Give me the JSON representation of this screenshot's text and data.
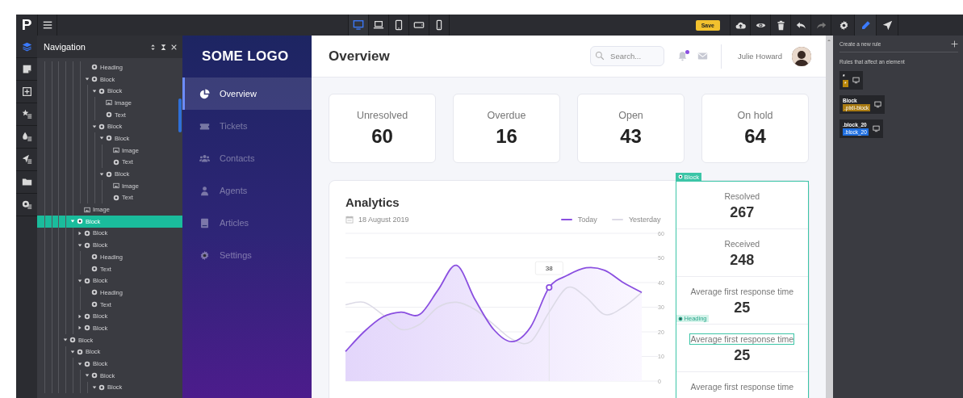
{
  "toolbar": {
    "logo": "P",
    "devices": [
      {
        "kind": "desktop",
        "selected": true
      },
      {
        "kind": "laptop",
        "selected": false
      },
      {
        "kind": "tablet",
        "selected": false
      },
      {
        "kind": "tablet-landscape",
        "selected": false
      },
      {
        "kind": "phone",
        "selected": false
      }
    ],
    "save": "Save",
    "tools": [
      {
        "kind": "upload",
        "disabled": false
      },
      {
        "kind": "preview",
        "disabled": false
      },
      {
        "kind": "delete",
        "disabled": false
      },
      {
        "kind": "undo",
        "disabled": false
      },
      {
        "kind": "redo",
        "disabled": true
      }
    ],
    "panels": [
      {
        "kind": "settings",
        "selected": false
      },
      {
        "kind": "style",
        "selected": true
      },
      {
        "kind": "publish",
        "selected": false
      }
    ]
  },
  "rail": [
    {
      "kind": "layers",
      "selected": true
    },
    {
      "kind": "page",
      "selected": false
    },
    {
      "kind": "add",
      "selected": false
    },
    {
      "kind": "favorites",
      "selected": false
    },
    {
      "kind": "theme",
      "selected": false
    },
    {
      "kind": "send",
      "selected": false
    },
    {
      "kind": "folder",
      "selected": false
    },
    {
      "kind": "settings",
      "selected": false
    }
  ],
  "navigator": {
    "title": "Navigation",
    "tree": [
      {
        "children": [
          {
            "children": [
              {
                "children": [
                  {
                    "label": "Heading",
                    "kind": "heading",
                    "selected": false
                  },
                  {
                    "label": "Block",
                    "kind": "block",
                    "expanded": true,
                    "selected": false,
                    "children": [
                      {
                        "label": "Block",
                        "kind": "block",
                        "expanded": true,
                        "selected": false,
                        "children": [
                          {
                            "label": "Image",
                            "kind": "image",
                            "selected": false
                          },
                          {
                            "label": "Text",
                            "kind": "text",
                            "selected": false
                          }
                        ]
                      },
                      {
                        "label": "Block",
                        "kind": "block",
                        "expanded": true,
                        "selected": false,
                        "children": [
                          {
                            "label": "Block",
                            "kind": "block",
                            "expanded": true,
                            "selected": false,
                            "children": [
                              {
                                "label": "Image",
                                "kind": "image",
                                "selected": false
                              },
                              {
                                "label": "Text",
                                "kind": "text",
                                "selected": false
                              }
                            ]
                          },
                          {
                            "label": "Block",
                            "kind": "block",
                            "expanded": true,
                            "selected": false,
                            "children": [
                              {
                                "label": "Image",
                                "kind": "image",
                                "selected": false
                              },
                              {
                                "label": "Text",
                                "kind": "text",
                                "selected": false
                              }
                            ]
                          }
                        ]
                      }
                    ]
                  }
                ]
              },
              {
                "label": "Image",
                "kind": "image",
                "selected": false
              }
            ]
          },
          {
            "label": "Block",
            "kind": "block",
            "expanded": true,
            "selected": true,
            "children": [
              {
                "label": "Block",
                "kind": "block",
                "expanded": false,
                "selected": false
              },
              {
                "label": "Block",
                "kind": "block",
                "expanded": true,
                "selected": false,
                "children": [
                  {
                    "label": "Heading",
                    "kind": "heading",
                    "selected": false
                  },
                  {
                    "label": "Text",
                    "kind": "text",
                    "selected": false
                  }
                ]
              },
              {
                "label": "Block",
                "kind": "block",
                "expanded": true,
                "selected": false,
                "children": [
                  {
                    "label": "Heading",
                    "kind": "heading",
                    "selected": false
                  },
                  {
                    "label": "Text",
                    "kind": "text",
                    "selected": false
                  }
                ]
              },
              {
                "label": "Block",
                "kind": "block",
                "expanded": false,
                "selected": false
              },
              {
                "label": "Block",
                "kind": "block",
                "expanded": false,
                "selected": false
              }
            ]
          }
        ]
      },
      {
        "label": "Block",
        "kind": "block",
        "expanded": true,
        "selected": false,
        "children": [
          {
            "label": "Block",
            "kind": "block",
            "expanded": true,
            "selected": false,
            "children": [
              {
                "label": "Block",
                "kind": "block",
                "expanded": true,
                "selected": false,
                "children": [
                  {
                    "label": "Block",
                    "kind": "block",
                    "expanded": true,
                    "selected": false,
                    "children": [
                      {
                        "label": "Block",
                        "kind": "block",
                        "expanded": true,
                        "selected": false
                      }
                    ]
                  }
                ]
              }
            ]
          }
        ]
      }
    ]
  },
  "site": {
    "logo": "SOME LOGO",
    "menu": [
      {
        "label": "Overview",
        "kind": "overview",
        "selected": true
      },
      {
        "label": "Tickets",
        "kind": "tickets",
        "selected": false
      },
      {
        "label": "Contacts",
        "kind": "contacts",
        "selected": false
      },
      {
        "label": "Agents",
        "kind": "agents",
        "selected": false
      },
      {
        "label": "Articles",
        "kind": "articles",
        "selected": false
      },
      {
        "label": "Settings",
        "kind": "settings",
        "selected": false
      }
    ],
    "header": {
      "title": "Overview",
      "search": {
        "placeholder": "Search..."
      },
      "notifications_unread": true,
      "user": "Julie Howard"
    },
    "stats": [
      {
        "label": "Unresolved",
        "value": "60"
      },
      {
        "label": "Overdue",
        "value": "16"
      },
      {
        "label": "Open",
        "value": "43"
      },
      {
        "label": "On hold",
        "value": "64"
      }
    ],
    "analytics": {
      "title": "Analytics",
      "date": "18 August 2019",
      "chart_data": {
        "type": "area",
        "grid": true,
        "ylim": [
          0,
          60
        ],
        "yticks": [
          0,
          10,
          20,
          30,
          40,
          50,
          60
        ],
        "series": [
          {
            "name": "Today",
            "color": "#8a4fe0",
            "values": [
              12,
              20,
              26,
              28,
              27,
              37,
              47,
              33,
              21,
              16,
              22,
              38,
              43,
              46,
              45,
              40,
              36
            ]
          },
          {
            "name": "Yesterday",
            "type": "line",
            "color": "#dcdae6",
            "values": [
              31,
              32,
              27,
              21,
              23,
              30,
              32,
              29,
              23,
              17,
              16,
              28,
              38,
              34,
              27,
              30,
              36
            ]
          }
        ],
        "annotations": [
          {
            "y": 38,
            "text": "38"
          }
        ]
      }
    },
    "side_stats": {
      "tag": "Block",
      "items": [
        {
          "label": "Resolved",
          "value": "267"
        },
        {
          "label": "Received",
          "value": "248"
        },
        {
          "label": "Average first response time",
          "value": "25"
        },
        {
          "label": "Average first response time",
          "value": "25",
          "tag": "Heading"
        },
        {
          "label": "Average first response time"
        }
      ]
    }
  },
  "rules": {
    "create": "Create a new rule",
    "heading": "Rules that affect an element",
    "items": [
      {
        "selector": "*",
        "class": "*",
        "color": "#b8860b"
      },
      {
        "selector": "Block",
        "class": ".pixli-block",
        "color": "#a87a12"
      },
      {
        "selector": ".block_20",
        "class": ".block_20",
        "color": "#1f6fe0"
      }
    ]
  }
}
